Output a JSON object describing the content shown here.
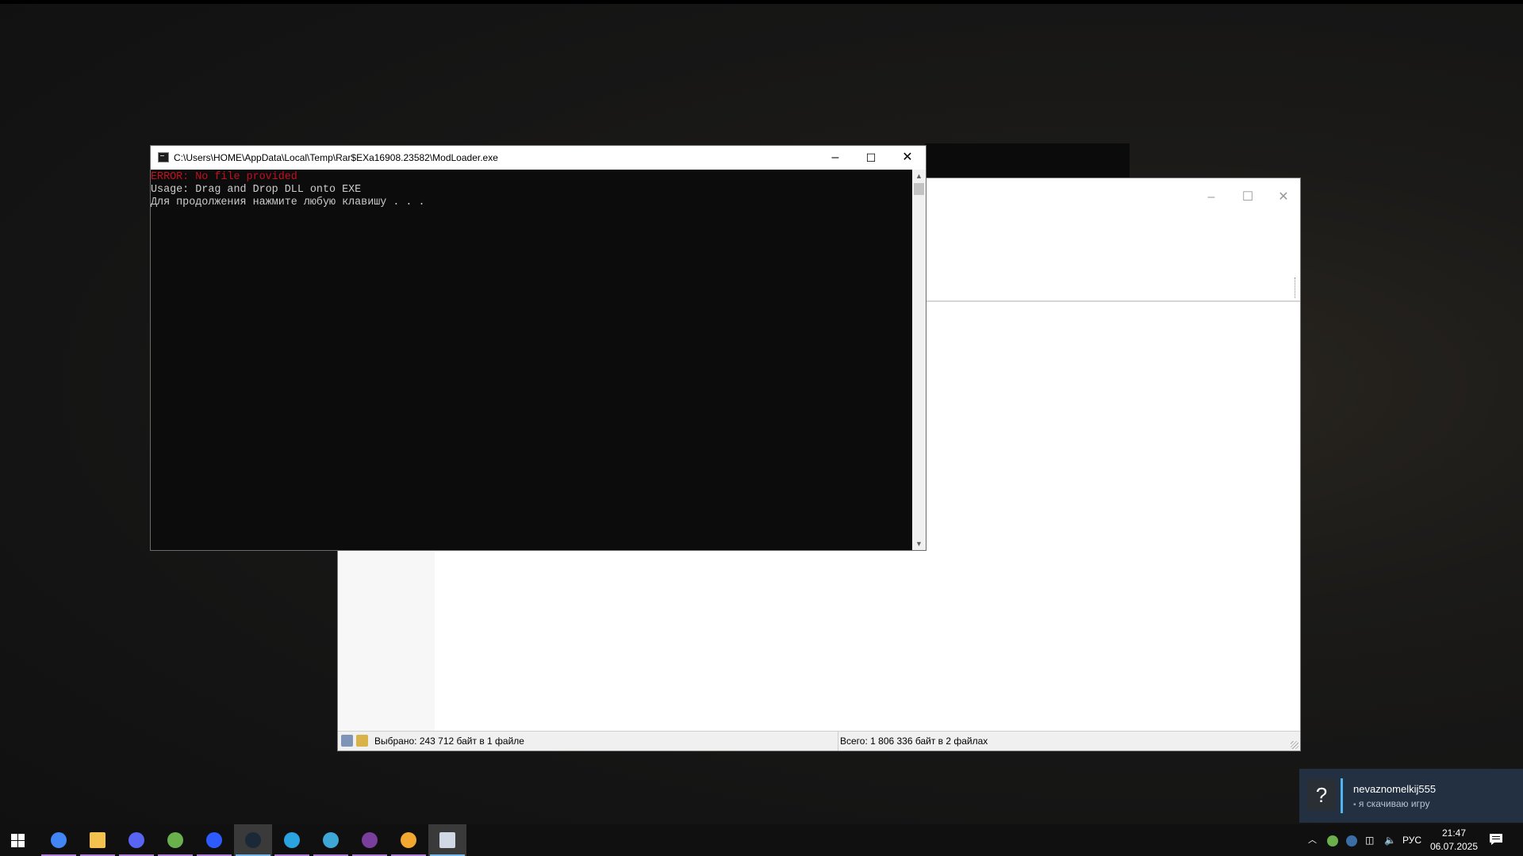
{
  "console": {
    "title": "C:\\Users\\HOME\\AppData\\Local\\Temp\\Rar$EXa16908.23582\\ModLoader.exe",
    "lines": [
      {
        "text": "ERROR: No file provided",
        "color": "#c50f1f"
      },
      {
        "text": "Usage: Drag and Drop DLL onto EXE",
        "color": "#cccccc"
      },
      {
        "text": "Для продолжения нажмите любую клавишу . . .",
        "color": "#cccccc"
      }
    ]
  },
  "archiver": {
    "status_selected": "Выбрано: 243 712 байт в 1 файле",
    "status_total": "Всего: 1 806 336 байт в 2 файлах"
  },
  "notification": {
    "icon_glyph": "?",
    "username": "nevaznomelkij555",
    "message": "я скачиваю игру"
  },
  "taskbar": {
    "apps": [
      {
        "name": "chrome-icon",
        "color": "#4285f4",
        "active": false
      },
      {
        "name": "file-explorer-icon",
        "color": "#f2c14e",
        "active": false
      },
      {
        "name": "discord-icon",
        "color": "#5865f2",
        "active": false
      },
      {
        "name": "utorrent-icon",
        "color": "#6ab04c",
        "active": false
      },
      {
        "name": "xbox-app-icon",
        "color": "#2d5bff",
        "active": false
      },
      {
        "name": "steam-icon",
        "color": "#1b2838",
        "active": true
      },
      {
        "name": "telegram-icon",
        "color": "#2aa3e0",
        "active": false
      },
      {
        "name": "launcher-icon",
        "color": "#3fa7d6",
        "active": false
      },
      {
        "name": "winrar-icon",
        "color": "#7a3e9d",
        "active": false
      },
      {
        "name": "game-mascot-icon",
        "color": "#f0a830",
        "active": false
      },
      {
        "name": "console-app-icon",
        "color": "#cfd8e3",
        "active": true
      }
    ],
    "language": "РУС",
    "time": "21:47",
    "date": "06.07.2025"
  }
}
